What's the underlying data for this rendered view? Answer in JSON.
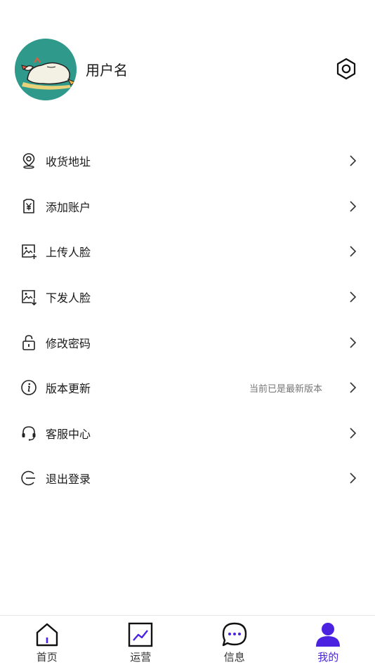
{
  "profile": {
    "username": "用户名"
  },
  "menu": {
    "items": [
      {
        "label": "收货地址",
        "hint": "",
        "icon": "location-pin-icon"
      },
      {
        "label": "添加账户",
        "hint": "",
        "icon": "yen-tag-icon"
      },
      {
        "label": "上传人脸",
        "hint": "",
        "icon": "image-add-icon"
      },
      {
        "label": "下发人脸",
        "hint": "",
        "icon": "image-download-icon"
      },
      {
        "label": "修改密码",
        "hint": "",
        "icon": "lock-icon"
      },
      {
        "label": "版本更新",
        "hint": "当前已是最新版本",
        "icon": "info-icon"
      },
      {
        "label": "客服中心",
        "hint": "",
        "icon": "headset-icon"
      },
      {
        "label": "退出登录",
        "hint": "",
        "icon": "logout-icon"
      }
    ]
  },
  "tabbar": {
    "tabs": [
      {
        "label": "首页",
        "icon": "home-icon"
      },
      {
        "label": "运营",
        "icon": "chart-icon"
      },
      {
        "label": "信息",
        "icon": "message-icon"
      },
      {
        "label": "我的",
        "icon": "user-icon"
      }
    ],
    "active_color": "#4a22e0"
  }
}
